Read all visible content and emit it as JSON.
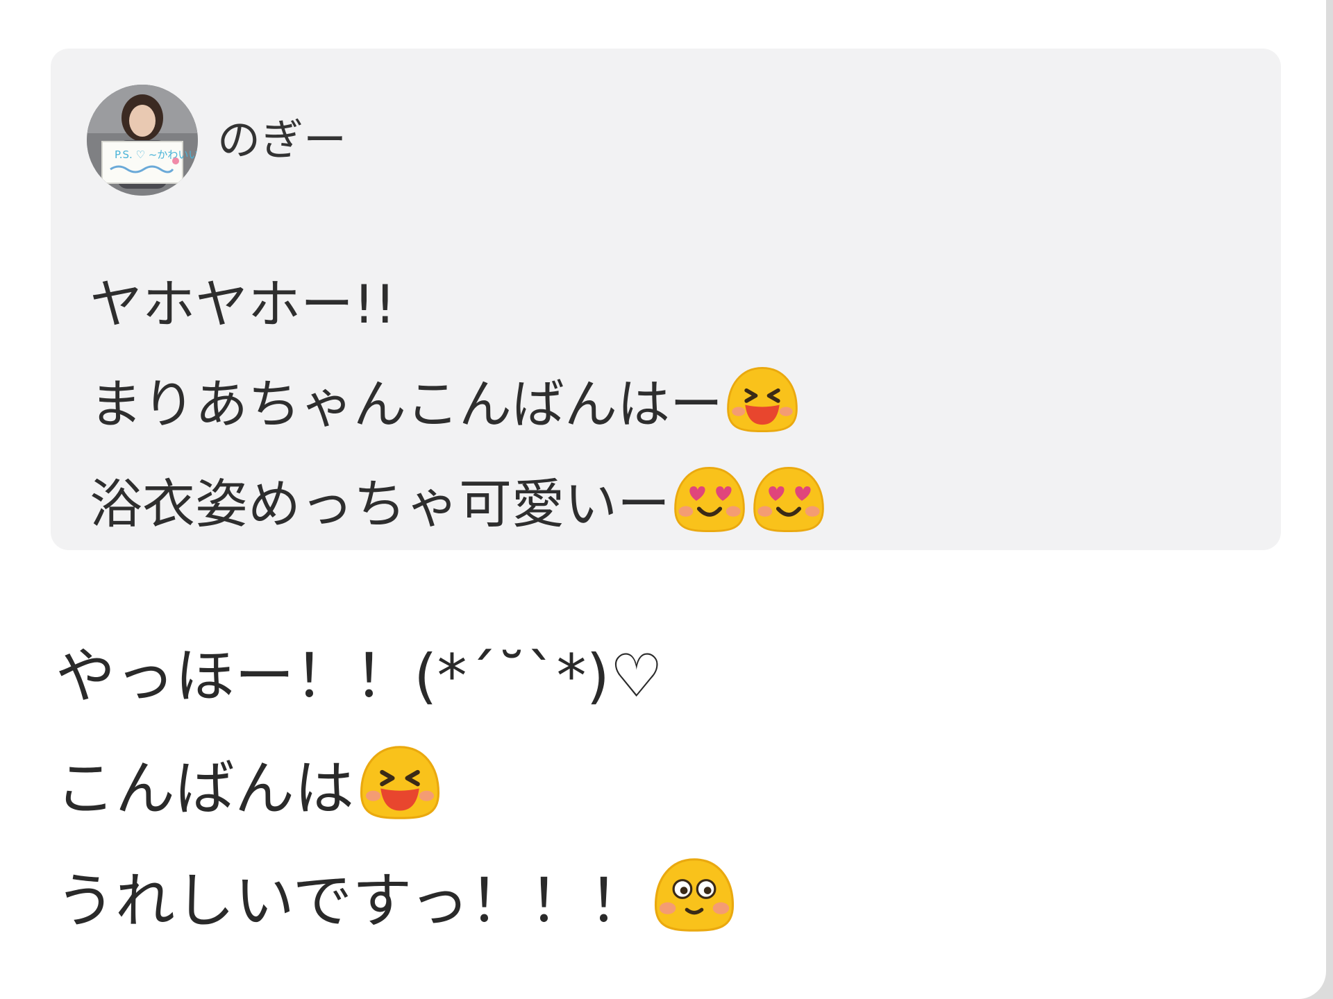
{
  "quote": {
    "author": "のぎー",
    "lines": [
      {
        "text": "ヤホヤホー!!",
        "emoji": []
      },
      {
        "text": "まりあちゃんこんばんはー",
        "emoji": [
          "grinning-squint-face-icon"
        ]
      },
      {
        "text": "浴衣姿めっちゃ可愛いー",
        "emoji": [
          "heart-eyes-face-icon",
          "heart-eyes-face-icon"
        ]
      }
    ],
    "avatar_sign_text": "P.S. ♡ ~かわいい~"
  },
  "reply": {
    "lines": [
      {
        "text": "やっほー！！(*´˘`*)♡",
        "emoji": []
      },
      {
        "text": "こんばんは",
        "emoji": [
          "grinning-squint-face-icon"
        ]
      },
      {
        "text": "うれしいですっ！！！",
        "emoji": [
          "flushed-smile-face-icon"
        ]
      }
    ]
  },
  "colors": {
    "card_background": "#ffffff",
    "quote_background": "#f2f2f3",
    "emoji_yellow": "#f9c21b",
    "blush": "#f3928a",
    "heart": "#e0457b"
  }
}
